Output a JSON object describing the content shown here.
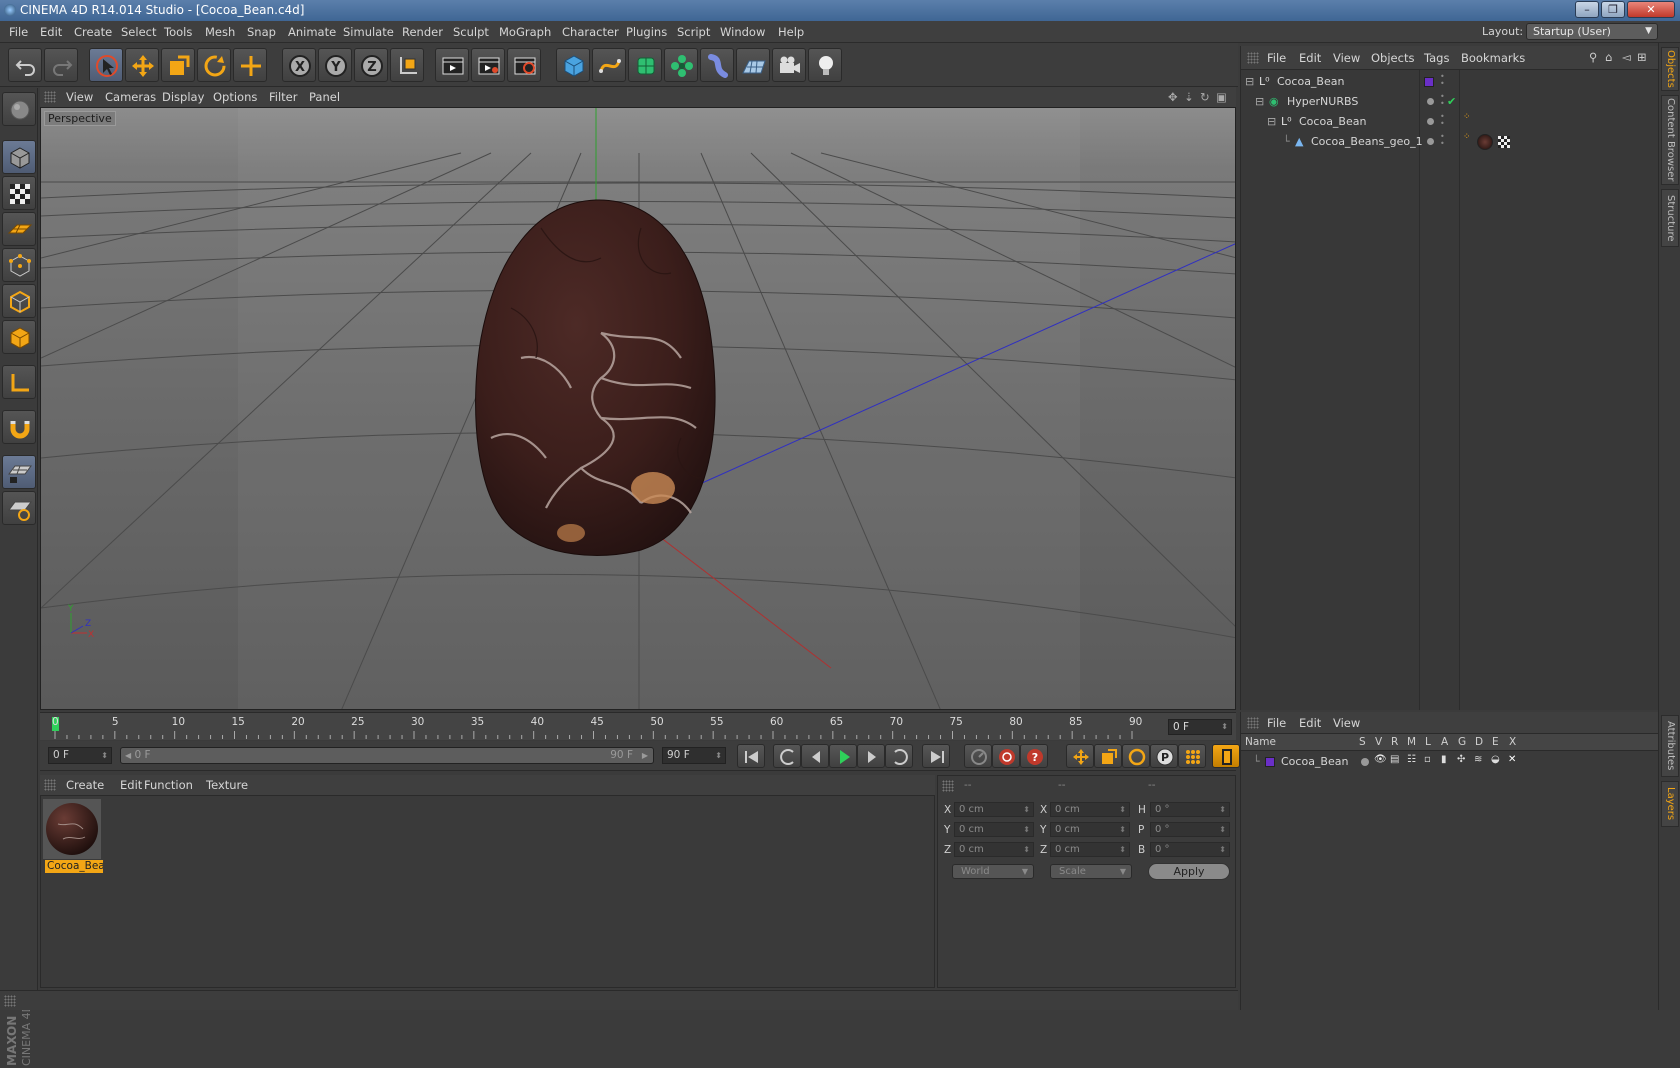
{
  "window": {
    "title": "CINEMA 4D R14.014 Studio - [Cocoa_Bean.c4d]",
    "controls": [
      "–",
      "❐",
      "✕"
    ]
  },
  "menubar": {
    "items": [
      "File",
      "Edit",
      "Create",
      "Select",
      "Tools",
      "Mesh",
      "Snap",
      "Animate",
      "Simulate",
      "Render",
      "Sculpt",
      "MoGraph",
      "Character",
      "Plugins",
      "Script",
      "Window",
      "Help"
    ],
    "layout_label": "Layout:",
    "layout_value": "Startup (User)"
  },
  "toolbar": {
    "icons": [
      "undo-icon",
      "redo-icon",
      "live-selection-icon",
      "move-icon",
      "scale-icon",
      "rotate-icon",
      "add-object-icon",
      "x-axis-icon",
      "y-axis-icon",
      "z-axis-icon",
      "coordinate-system-icon",
      "render-view-icon",
      "render-picture-viewer-icon",
      "render-settings-icon",
      "cube-icon",
      "spline-pen-icon",
      "nurbs-icon",
      "mograph-cloner-icon",
      "deformer-icon",
      "floor-icon",
      "camera-icon",
      "light-icon"
    ]
  },
  "viewport": {
    "menu": [
      "View",
      "Cameras",
      "Display",
      "Options",
      "Filter",
      "Panel"
    ],
    "label": "Perspective",
    "axis_labels": {
      "y": "Y",
      "x": "X",
      "z": "Z"
    }
  },
  "timeline": {
    "ticks": [
      "0",
      "5",
      "10",
      "15",
      "20",
      "25",
      "30",
      "35",
      "40",
      "45",
      "50",
      "55",
      "60",
      "65",
      "70",
      "75",
      "80",
      "85",
      "90"
    ],
    "current_frame": "0 F",
    "max_frames": 90
  },
  "transport": {
    "start_field": "0 F",
    "range_start": "0 F",
    "range_end": "90 F",
    "end_field": "90 F"
  },
  "material_manager": {
    "menu": [
      "Create",
      "Edit",
      "Function",
      "Texture"
    ],
    "material_name": "Cocoa_Bea"
  },
  "coordinates": {
    "headers": [
      "--",
      "--",
      "--"
    ],
    "rows": [
      {
        "a_label": "X",
        "a_value": "0 cm",
        "b_label": "X",
        "b_value": "0 cm",
        "c_label": "H",
        "c_value": "0 °"
      },
      {
        "a_label": "Y",
        "a_value": "0 cm",
        "b_label": "Y",
        "b_value": "0 cm",
        "c_label": "P",
        "c_value": "0 °"
      },
      {
        "a_label": "Z",
        "a_value": "0 cm",
        "b_label": "Z",
        "b_value": "0 cm",
        "c_label": "B",
        "c_value": "0 °"
      }
    ],
    "world_dropdown": "World",
    "scale_dropdown": "Scale",
    "apply_label": "Apply"
  },
  "object_manager": {
    "menu": [
      "File",
      "Edit",
      "View",
      "Objects",
      "Tags",
      "Bookmarks"
    ],
    "objects": [
      {
        "name": "Cocoa_Bean",
        "indent": 0,
        "icon": "null-object-icon"
      },
      {
        "name": "HyperNURBS",
        "indent": 1,
        "icon": "hypernurbs-icon"
      },
      {
        "name": "Cocoa_Bean",
        "indent": 2,
        "icon": "null-object-icon"
      },
      {
        "name": "Cocoa_Beans_geo_1",
        "indent": 3,
        "icon": "polygon-object-icon"
      }
    ]
  },
  "layers_panel": {
    "menu": [
      "File",
      "Edit",
      "View"
    ],
    "columns": [
      "Name",
      "S",
      "V",
      "R",
      "M",
      "L",
      "A",
      "G",
      "D",
      "E",
      "X"
    ],
    "layer_name": "Cocoa_Bean",
    "layer_color": "#6a2fc7"
  },
  "side_tabs": [
    "Objects",
    "Content Browser",
    "Structure",
    "Attributes",
    "Layers"
  ],
  "branding": "MAXON CINEMA 4D",
  "colors": {
    "accent": "#f3a615",
    "selection": "#6b7a95"
  }
}
